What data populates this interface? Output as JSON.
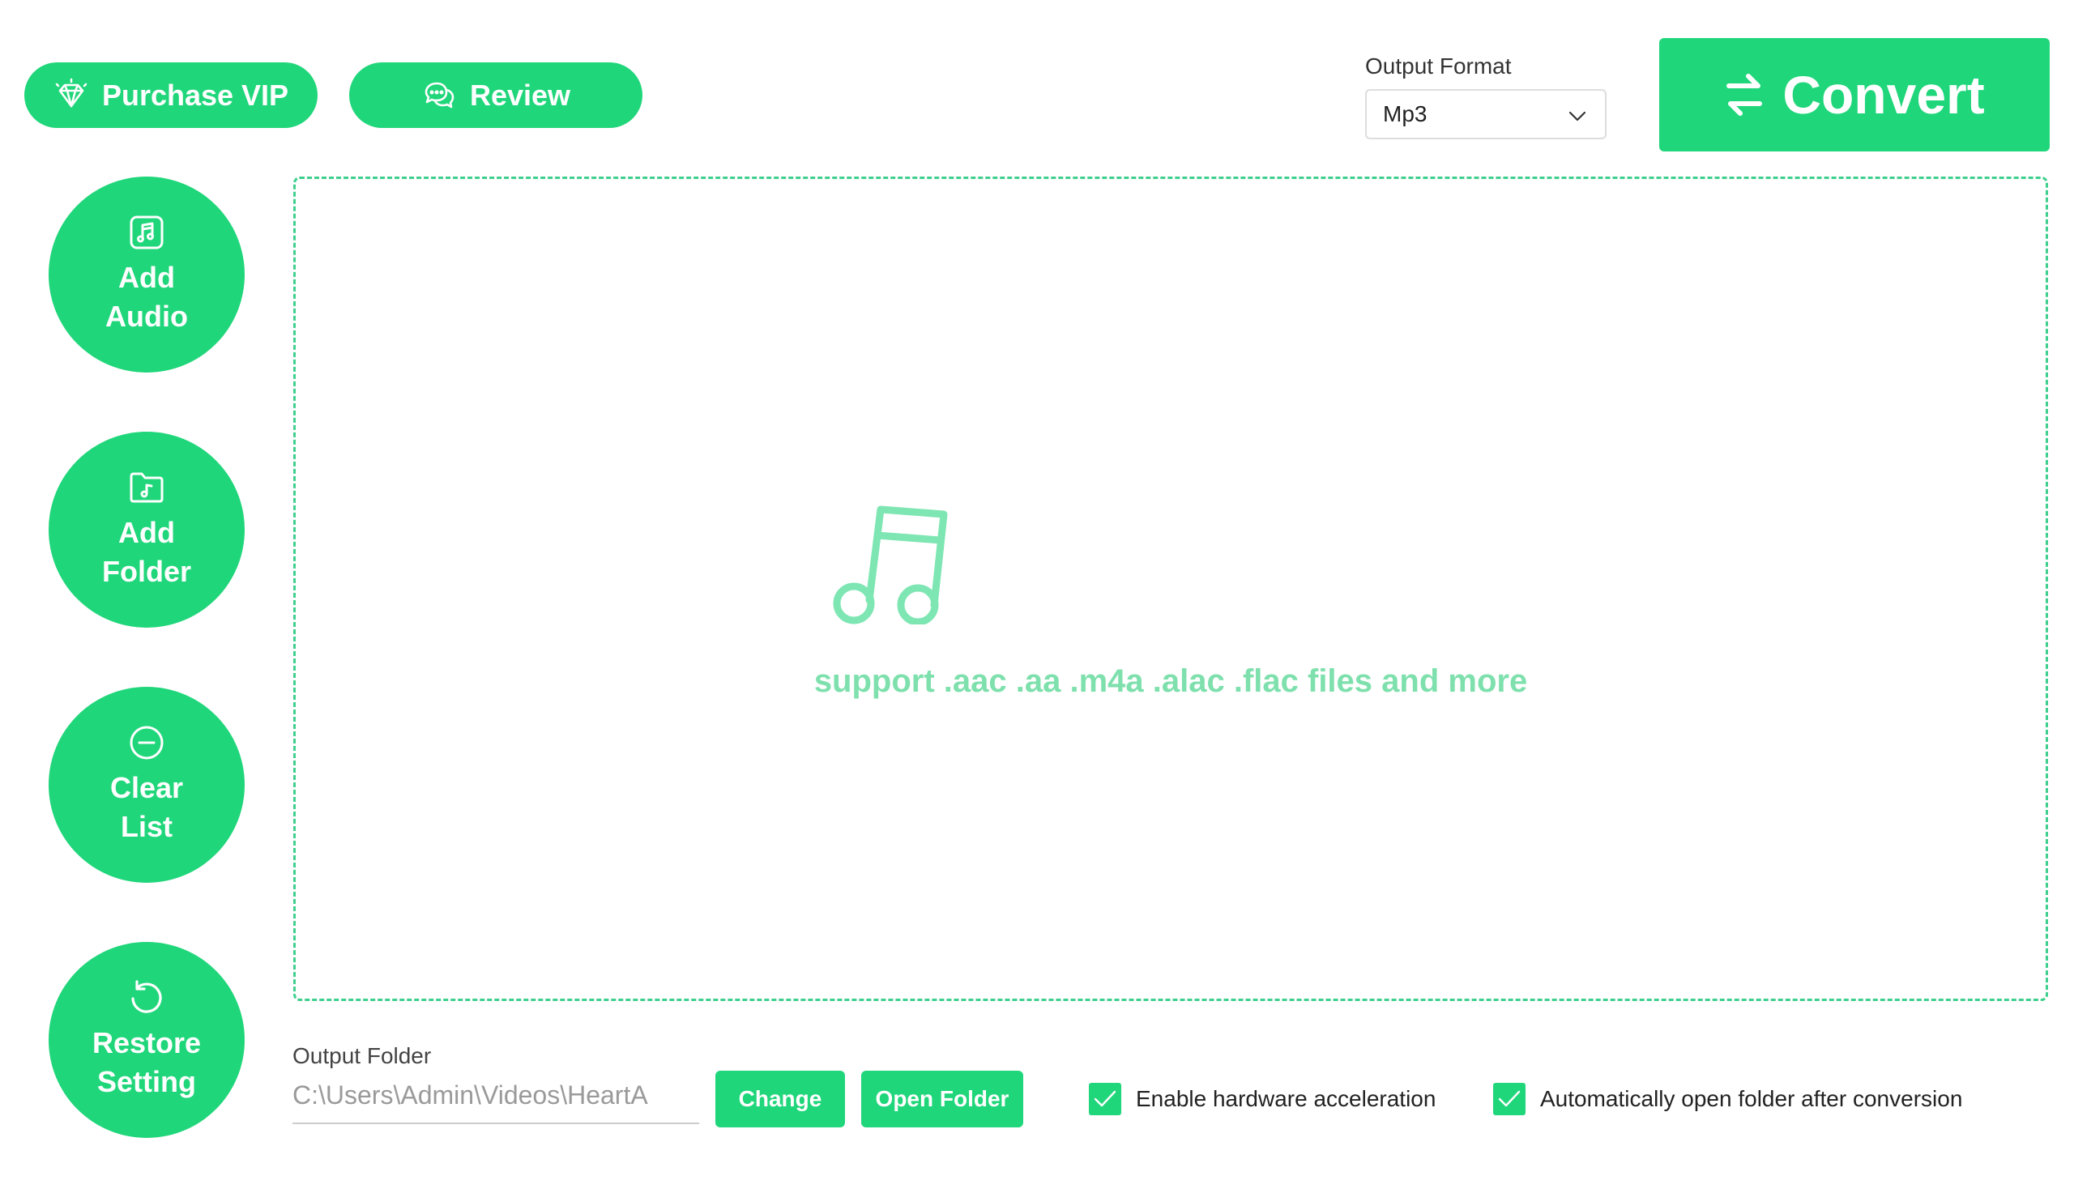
{
  "colors": {
    "accent": "#20d67a",
    "dashed_border": "#3ecf8e",
    "support_text": "#7ee0ad",
    "note_icon": "#7ee6b3"
  },
  "top_bar": {
    "purchase_vip_label": "Purchase VIP",
    "purchase_vip_icon": "diamond-icon",
    "review_label": "Review",
    "review_icon": "chat-bubbles-icon"
  },
  "output_format": {
    "label": "Output Format",
    "selected": "Mp3"
  },
  "convert": {
    "label": "Convert",
    "icon": "swap-arrows-icon"
  },
  "sidebar": {
    "items": [
      {
        "line1": "Add",
        "line2": "Audio",
        "icon": "music-file-icon"
      },
      {
        "line1": "Add",
        "line2": "Folder",
        "icon": "music-folder-icon"
      },
      {
        "line1": "Clear",
        "line2": "List",
        "icon": "minus-circle-icon"
      },
      {
        "line1": "Restore",
        "line2": "Setting",
        "icon": "restore-icon"
      }
    ]
  },
  "dropzone": {
    "icon": "music-note-icon",
    "support_text": "support .aac .aa .m4a .alac .flac files and more"
  },
  "output_folder": {
    "label": "Output Folder",
    "path": "C:\\Users\\Admin\\Videos\\HeartA",
    "change_label": "Change",
    "open_folder_label": "Open Folder"
  },
  "options": {
    "hardware_acceleration_label": "Enable hardware acceleration",
    "hardware_acceleration_checked": true,
    "auto_open_label": "Automatically open folder after conversion",
    "auto_open_checked": true
  }
}
